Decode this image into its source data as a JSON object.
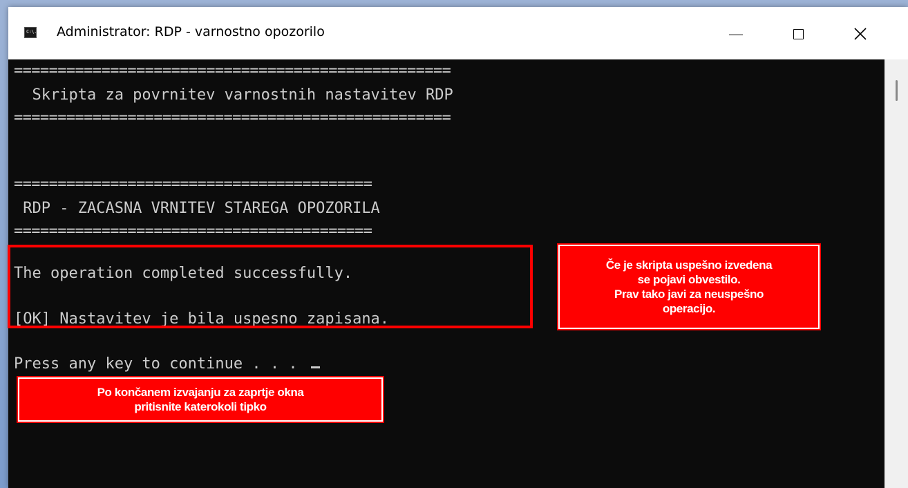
{
  "window": {
    "title": "Administrator:  RDP - varnostno opozorilo",
    "icon_name": "console-icon",
    "icon_text": "C:\\."
  },
  "console": {
    "separator_long": "==================================================",
    "header_title": "  Skripta za povrnitev varnostnih nastavitev RDP",
    "separator_short": "=========================================",
    "section_title": " RDP - ZACASNA VRNITEV STAREGA OPOZORILA",
    "result_line_1": "The operation completed successfully.",
    "result_line_2": "[OK] Nastavitev je bila uspesno zapisana.",
    "prompt": "Press any key to continue . . . "
  },
  "annotations": {
    "success_note": {
      "lines": [
        "Če je skripta uspešno izvedena",
        "se pojavi obvestilo.",
        "Prav tako javi za neuspešno",
        "operacijo."
      ]
    },
    "close_note": {
      "lines": [
        "Po končanem izvajanju za zaprtje okna",
        "pritisnite katerokoli tipko"
      ]
    }
  },
  "colors": {
    "console_bg": "#0c0c0c",
    "console_text": "#cccccc",
    "annotation_red": "#ff0000",
    "annotation_text": "#ffffff"
  }
}
